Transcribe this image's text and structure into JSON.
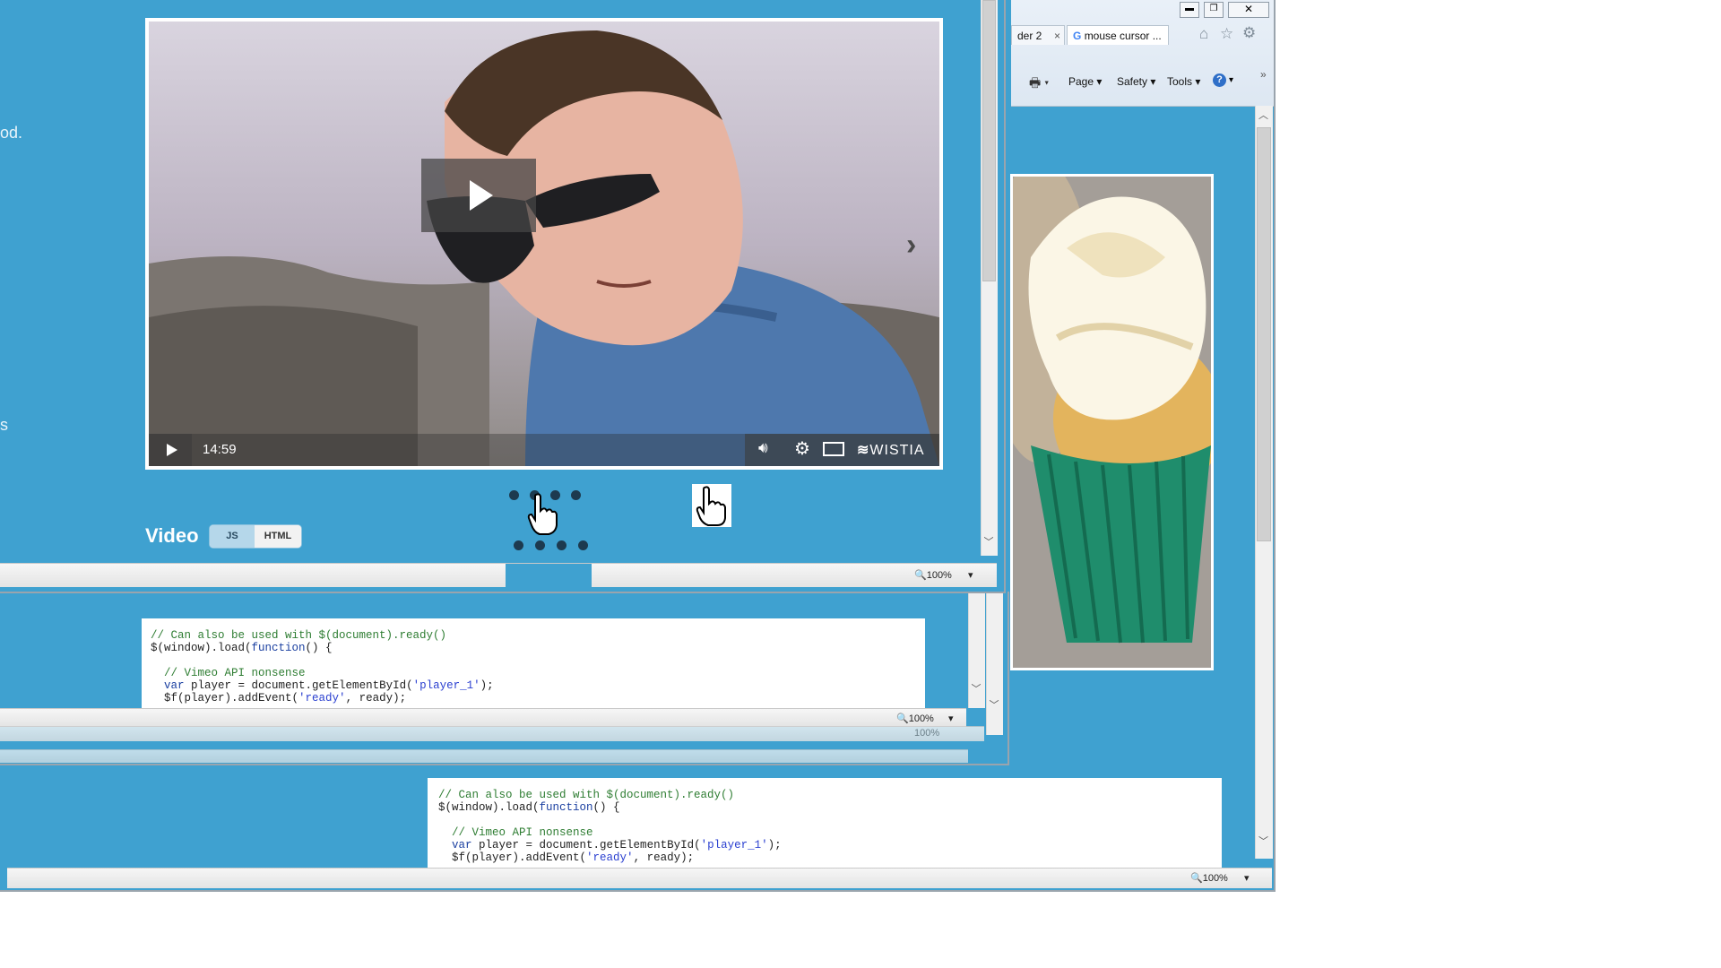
{
  "back_window": {
    "tabs": [
      {
        "label": "der 2",
        "close": "×"
      },
      {
        "label": "mouse cursor ..."
      }
    ],
    "toolbar": {
      "page": "Page",
      "safety": "Safety",
      "tools": "Tools"
    },
    "code": {
      "line1": "// Can also be used with $(document).ready()",
      "line2_a": "$(window).load(",
      "line2_kw": "function",
      "line2_b": "() {",
      "line3": "// Vimeo API nonsense",
      "line4_kw": "var",
      "line4_a": " player = document.getElementById(",
      "line4_str": "'player_1'",
      "line4_b": ");",
      "line5_a": "$f(player).addEvent(",
      "line5_str": "'ready'",
      "line5_b": ", ready);"
    },
    "zoom": "100%"
  },
  "front_window": {
    "left_text_1": "od.",
    "left_text_2": "s",
    "video": {
      "time": "14:59",
      "brand": "WISTIA"
    },
    "section_title": "Video",
    "toggle": {
      "js": "JS",
      "html": "HTML"
    },
    "zoom": "100%"
  },
  "middle_window": {
    "code": {
      "line1": "// Can also be used with $(document).ready()",
      "line2_a": "$(window).load(",
      "line2_kw": "function",
      "line2_b": "() {",
      "line3": "// Vimeo API nonsense",
      "line4_kw": "var",
      "line4_a": " player = document.getElementById(",
      "line4_str": "'player_1'",
      "line4_b": ");",
      "line5_a": "$f(player).addEvent(",
      "line5_str": "'ready'",
      "line5_b": ", ready);"
    },
    "zoom": "100%",
    "zoom_ghost": "100%"
  },
  "colors": {
    "page_blue": "#3fa1d0",
    "dot_dark": "#1d3a4f"
  }
}
